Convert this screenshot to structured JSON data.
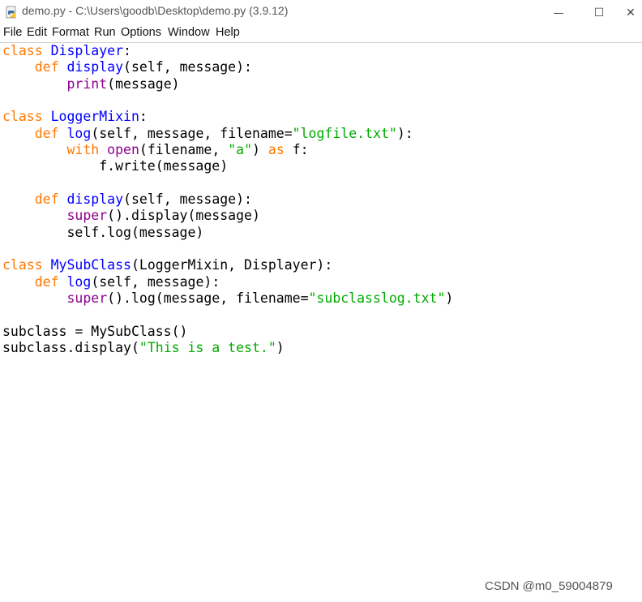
{
  "window": {
    "title": "demo.py - C:\\Users\\goodb\\Desktop\\demo.py (3.9.12)",
    "icon": "python-file-icon",
    "controls": {
      "minimize": "—",
      "maximize": "☐",
      "close": "✕"
    }
  },
  "menu": {
    "items": [
      "File",
      "Edit",
      "Format",
      "Run",
      "Options",
      "Window",
      "Help"
    ]
  },
  "colors": {
    "keyword": "#ff7700",
    "definition": "#0000ff",
    "builtin": "#900090",
    "string": "#00aa00",
    "text": "#000000"
  },
  "code": {
    "lines": [
      [
        {
          "t": "kw",
          "s": "class"
        },
        {
          "t": "",
          "s": " "
        },
        {
          "t": "def",
          "s": "Displayer"
        },
        {
          "t": "",
          "s": ":"
        }
      ],
      [
        {
          "t": "",
          "s": "    "
        },
        {
          "t": "kw",
          "s": "def"
        },
        {
          "t": "",
          "s": " "
        },
        {
          "t": "def",
          "s": "display"
        },
        {
          "t": "",
          "s": "(self, message):"
        }
      ],
      [
        {
          "t": "",
          "s": "        "
        },
        {
          "t": "bi",
          "s": "print"
        },
        {
          "t": "",
          "s": "(message)"
        }
      ],
      [],
      [
        {
          "t": "kw",
          "s": "class"
        },
        {
          "t": "",
          "s": " "
        },
        {
          "t": "def",
          "s": "LoggerMixin"
        },
        {
          "t": "",
          "s": ":"
        }
      ],
      [
        {
          "t": "",
          "s": "    "
        },
        {
          "t": "kw",
          "s": "def"
        },
        {
          "t": "",
          "s": " "
        },
        {
          "t": "def",
          "s": "log"
        },
        {
          "t": "",
          "s": "(self, message, filename="
        },
        {
          "t": "str",
          "s": "\"logfile.txt\""
        },
        {
          "t": "",
          "s": "):"
        }
      ],
      [
        {
          "t": "",
          "s": "        "
        },
        {
          "t": "kw",
          "s": "with"
        },
        {
          "t": "",
          "s": " "
        },
        {
          "t": "bi",
          "s": "open"
        },
        {
          "t": "",
          "s": "(filename, "
        },
        {
          "t": "str",
          "s": "\"a\""
        },
        {
          "t": "",
          "s": ") "
        },
        {
          "t": "kw",
          "s": "as"
        },
        {
          "t": "",
          "s": " f:"
        }
      ],
      [
        {
          "t": "",
          "s": "            f.write(message)"
        }
      ],
      [],
      [
        {
          "t": "",
          "s": "    "
        },
        {
          "t": "kw",
          "s": "def"
        },
        {
          "t": "",
          "s": " "
        },
        {
          "t": "def",
          "s": "display"
        },
        {
          "t": "",
          "s": "(self, message):"
        }
      ],
      [
        {
          "t": "",
          "s": "        "
        },
        {
          "t": "bi",
          "s": "super"
        },
        {
          "t": "",
          "s": "().display(message)"
        }
      ],
      [
        {
          "t": "",
          "s": "        self.log(message)"
        }
      ],
      [],
      [
        {
          "t": "kw",
          "s": "class"
        },
        {
          "t": "",
          "s": " "
        },
        {
          "t": "def",
          "s": "MySubClass"
        },
        {
          "t": "",
          "s": "(LoggerMixin, Displayer):"
        }
      ],
      [
        {
          "t": "",
          "s": "    "
        },
        {
          "t": "kw",
          "s": "def"
        },
        {
          "t": "",
          "s": " "
        },
        {
          "t": "def",
          "s": "log"
        },
        {
          "t": "",
          "s": "(self, message):"
        }
      ],
      [
        {
          "t": "",
          "s": "        "
        },
        {
          "t": "bi",
          "s": "super"
        },
        {
          "t": "",
          "s": "().log(message, filename="
        },
        {
          "t": "str",
          "s": "\"subclasslog.txt\""
        },
        {
          "t": "",
          "s": ")"
        }
      ],
      [],
      [
        {
          "t": "",
          "s": "subclass = MySubClass()"
        }
      ],
      [
        {
          "t": "",
          "s": "subclass.display("
        },
        {
          "t": "str",
          "s": "\"This is a test.\""
        },
        {
          "t": "",
          "s": ")"
        }
      ]
    ]
  },
  "watermark": "CSDN @m0_59004879"
}
